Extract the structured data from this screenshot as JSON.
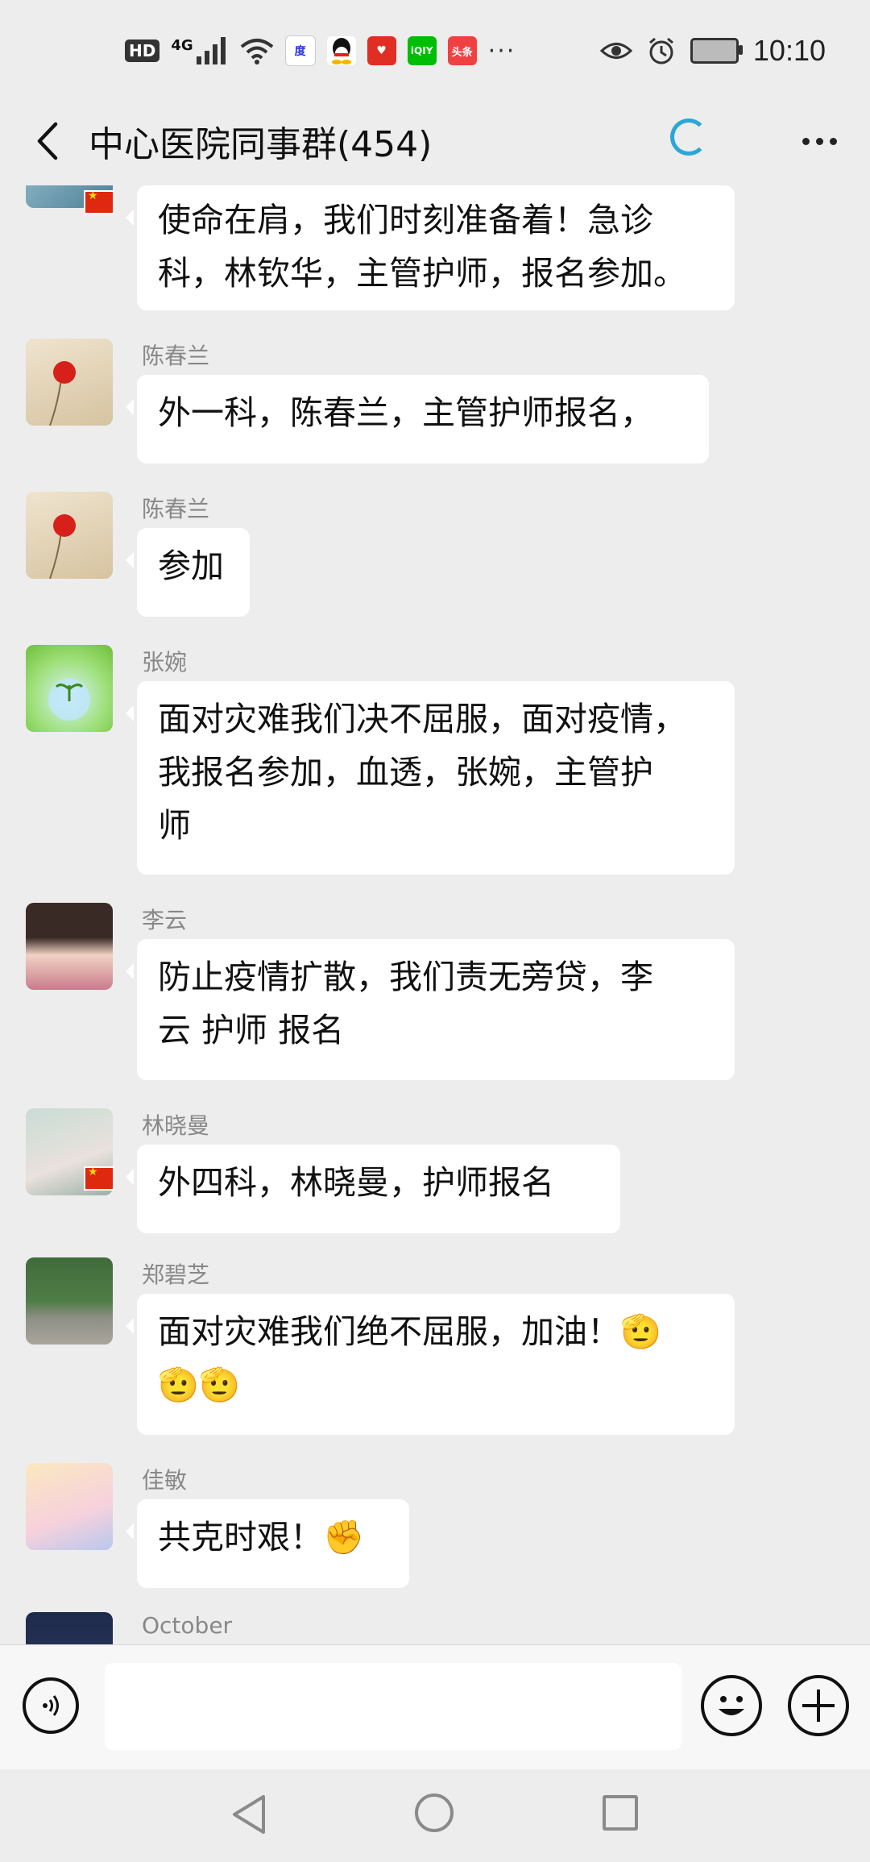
{
  "status_bar": {
    "network_badge": "HD",
    "network_type": "4G",
    "app_icon_toutiao": "头条",
    "more_indicator": "···",
    "time": "10:10"
  },
  "header": {
    "title": "中心医院同事群(454)"
  },
  "messages": [
    {
      "sender": "",
      "lines": [
        "使命在肩，我们时刻准备着！急诊",
        "科，林钦华，主管护师，报名参加。"
      ]
    },
    {
      "sender": "陈春兰",
      "lines": [
        "外一科，陈春兰，主管护师报名，"
      ]
    },
    {
      "sender": "陈春兰",
      "lines": [
        "参加"
      ]
    },
    {
      "sender": "张婉",
      "lines": [
        "面对灾难我们决不屈服，面对疫情，",
        "我报名参加，血透，张婉，主管护",
        "师"
      ]
    },
    {
      "sender": "李云",
      "lines": [
        "防止疫情扩散，我们责无旁贷，李",
        "云 护师 报名"
      ]
    },
    {
      "sender": "林晓曼",
      "lines": [
        "外四科，林晓曼，护师报名"
      ]
    },
    {
      "sender": "郑碧芝",
      "lines": [
        "面对灾难我们绝不屈服，加油！🫡",
        "🫡🫡"
      ]
    },
    {
      "sender": "佳敏",
      "lines": [
        "共克时艰！✊"
      ]
    },
    {
      "sender": "October",
      "lines": []
    }
  ],
  "input": {
    "placeholder": ""
  },
  "colors": {
    "background": "#ededed",
    "bubble": "#ffffff",
    "accent_loading": "#2aa7d8",
    "flag_red": "#de2910"
  }
}
